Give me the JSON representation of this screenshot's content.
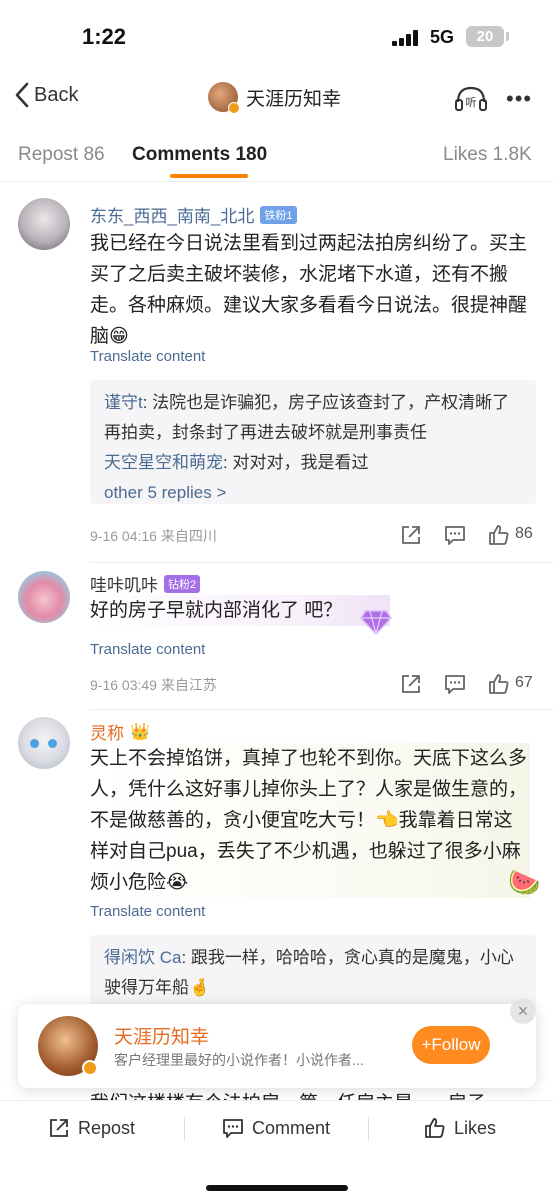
{
  "status": {
    "time": "1:22",
    "network": "5G",
    "battery": "20"
  },
  "nav": {
    "back_label": "Back",
    "title": "天涯历知幸"
  },
  "tabs": [
    {
      "label": "Repost 86"
    },
    {
      "label": "Comments 180"
    },
    {
      "label": "Likes 1.8K"
    }
  ],
  "comments": [
    {
      "username": "东东_西西_南南_北北",
      "badge": "铁粉1",
      "text": "我已经在今日说法里看到过两起法拍房纠纷了。买主买了之后卖主破坏装修，水泥堵下水道，还有不搬走。各种麻烦。建议大家多看看今日说法。很提神醒脑😁",
      "translate": "Translate content",
      "replies": [
        {
          "user": "谨守t",
          "text": ": 法院也是诈骗犯，房子应该查封了，产权清晰了再拍卖，封条封了再进去破坏就是刑事责任"
        },
        {
          "user": "天空星空和萌宠",
          "text": ": 对对对，我是看过"
        }
      ],
      "more_replies": "other 5 replies >",
      "meta": "9-16 04:16  来自四川",
      "likes": "86"
    },
    {
      "username": "哇咔叽咔",
      "badge": "钻粉2",
      "text": "好的房子早就内部消化了 吧？",
      "translate": "Translate content",
      "meta": "9-16 03:49  来自江苏",
      "likes": "67"
    },
    {
      "username": "灵称",
      "text": "天上不会掉馅饼，真掉了也轮不到你。天底下这么多人，凭什么这好事儿掉你头上了？人家是做生意的，不是做慈善的，贪小便宜吃大亏！👈我靠着日常这样对自己pua，丢失了不少机遇，也躲过了很多小麻烦小危险😭",
      "translate": "Translate content",
      "replies": [
        {
          "user": "得闲饮 Ca",
          "text": ": 跟我一样，哈哈哈，贪心真的是魔鬼，小心驶得万年船🤞"
        }
      ]
    }
  ],
  "partial_text": "我们这楼楼有个法拍房，第一任房主是...，房子",
  "follow_card": {
    "name": "天涯历知幸",
    "description": "客户经理里最好的小说作者！小说作者...",
    "follow_label": "+Follow",
    "close": "×"
  },
  "bottom_bar": {
    "repost": "Repost",
    "comment": "Comment",
    "likes": "Likes"
  },
  "colors": {
    "accent": "#ff8200",
    "link": "#4c6b93",
    "name_highlight": "#e86a20"
  }
}
